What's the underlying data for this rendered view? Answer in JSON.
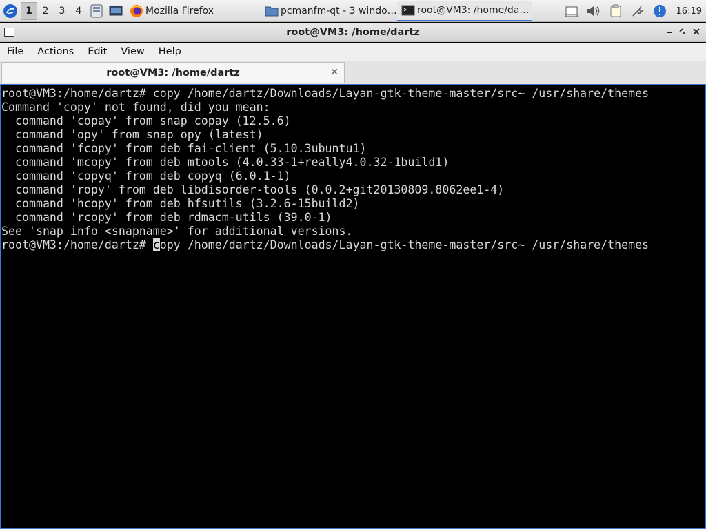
{
  "panel": {
    "workspaces": [
      "1",
      "2",
      "3",
      "4"
    ],
    "active_workspace": "1",
    "tasks": [
      {
        "label": "Mozilla Firefox",
        "icon": "firefox-icon"
      },
      {
        "label": "pcmanfm-qt - 3 windo…",
        "icon": "folder-icon"
      },
      {
        "label": "root@VM3: /home/da…",
        "icon": "terminal-icon"
      }
    ],
    "clock": "16:19"
  },
  "window": {
    "title": "root@VM3: /home/dartz",
    "menu": [
      "File",
      "Actions",
      "Edit",
      "View",
      "Help"
    ],
    "tab_label": "root@VM3: /home/dartz",
    "tab_close": "✕"
  },
  "terminal": {
    "lines": [
      "root@VM3:/home/dartz# copy /home/dartz/Downloads/Layan-gtk-theme-master/src~ /usr/share/themes",
      "Command 'copy' not found, did you mean:",
      "  command 'copay' from snap copay (12.5.6)",
      "  command 'opy' from snap opy (latest)",
      "  command 'fcopy' from deb fai-client (5.10.3ubuntu1)",
      "  command 'mcopy' from deb mtools (4.0.33-1+really4.0.32-1build1)",
      "  command 'copyq' from deb copyq (6.0.1-1)",
      "  command 'ropy' from deb libdisorder-tools (0.0.2+git20130809.8062ee1-4)",
      "  command 'hcopy' from deb hfsutils (3.2.6-15build2)",
      "  command 'rcopy' from deb rdmacm-utils (39.0-1)",
      "See 'snap info <snapname>' for additional versions."
    ],
    "prompt": "root@VM3:/home/dartz# ",
    "cursor_char": "c",
    "after_cursor": "opy /home/dartz/Downloads/Layan-gtk-theme-master/src~ /usr/share/themes"
  },
  "colors": {
    "accent": "#3a78d2",
    "terminal_bg": "#000000",
    "terminal_fg": "#d8d8d8"
  }
}
